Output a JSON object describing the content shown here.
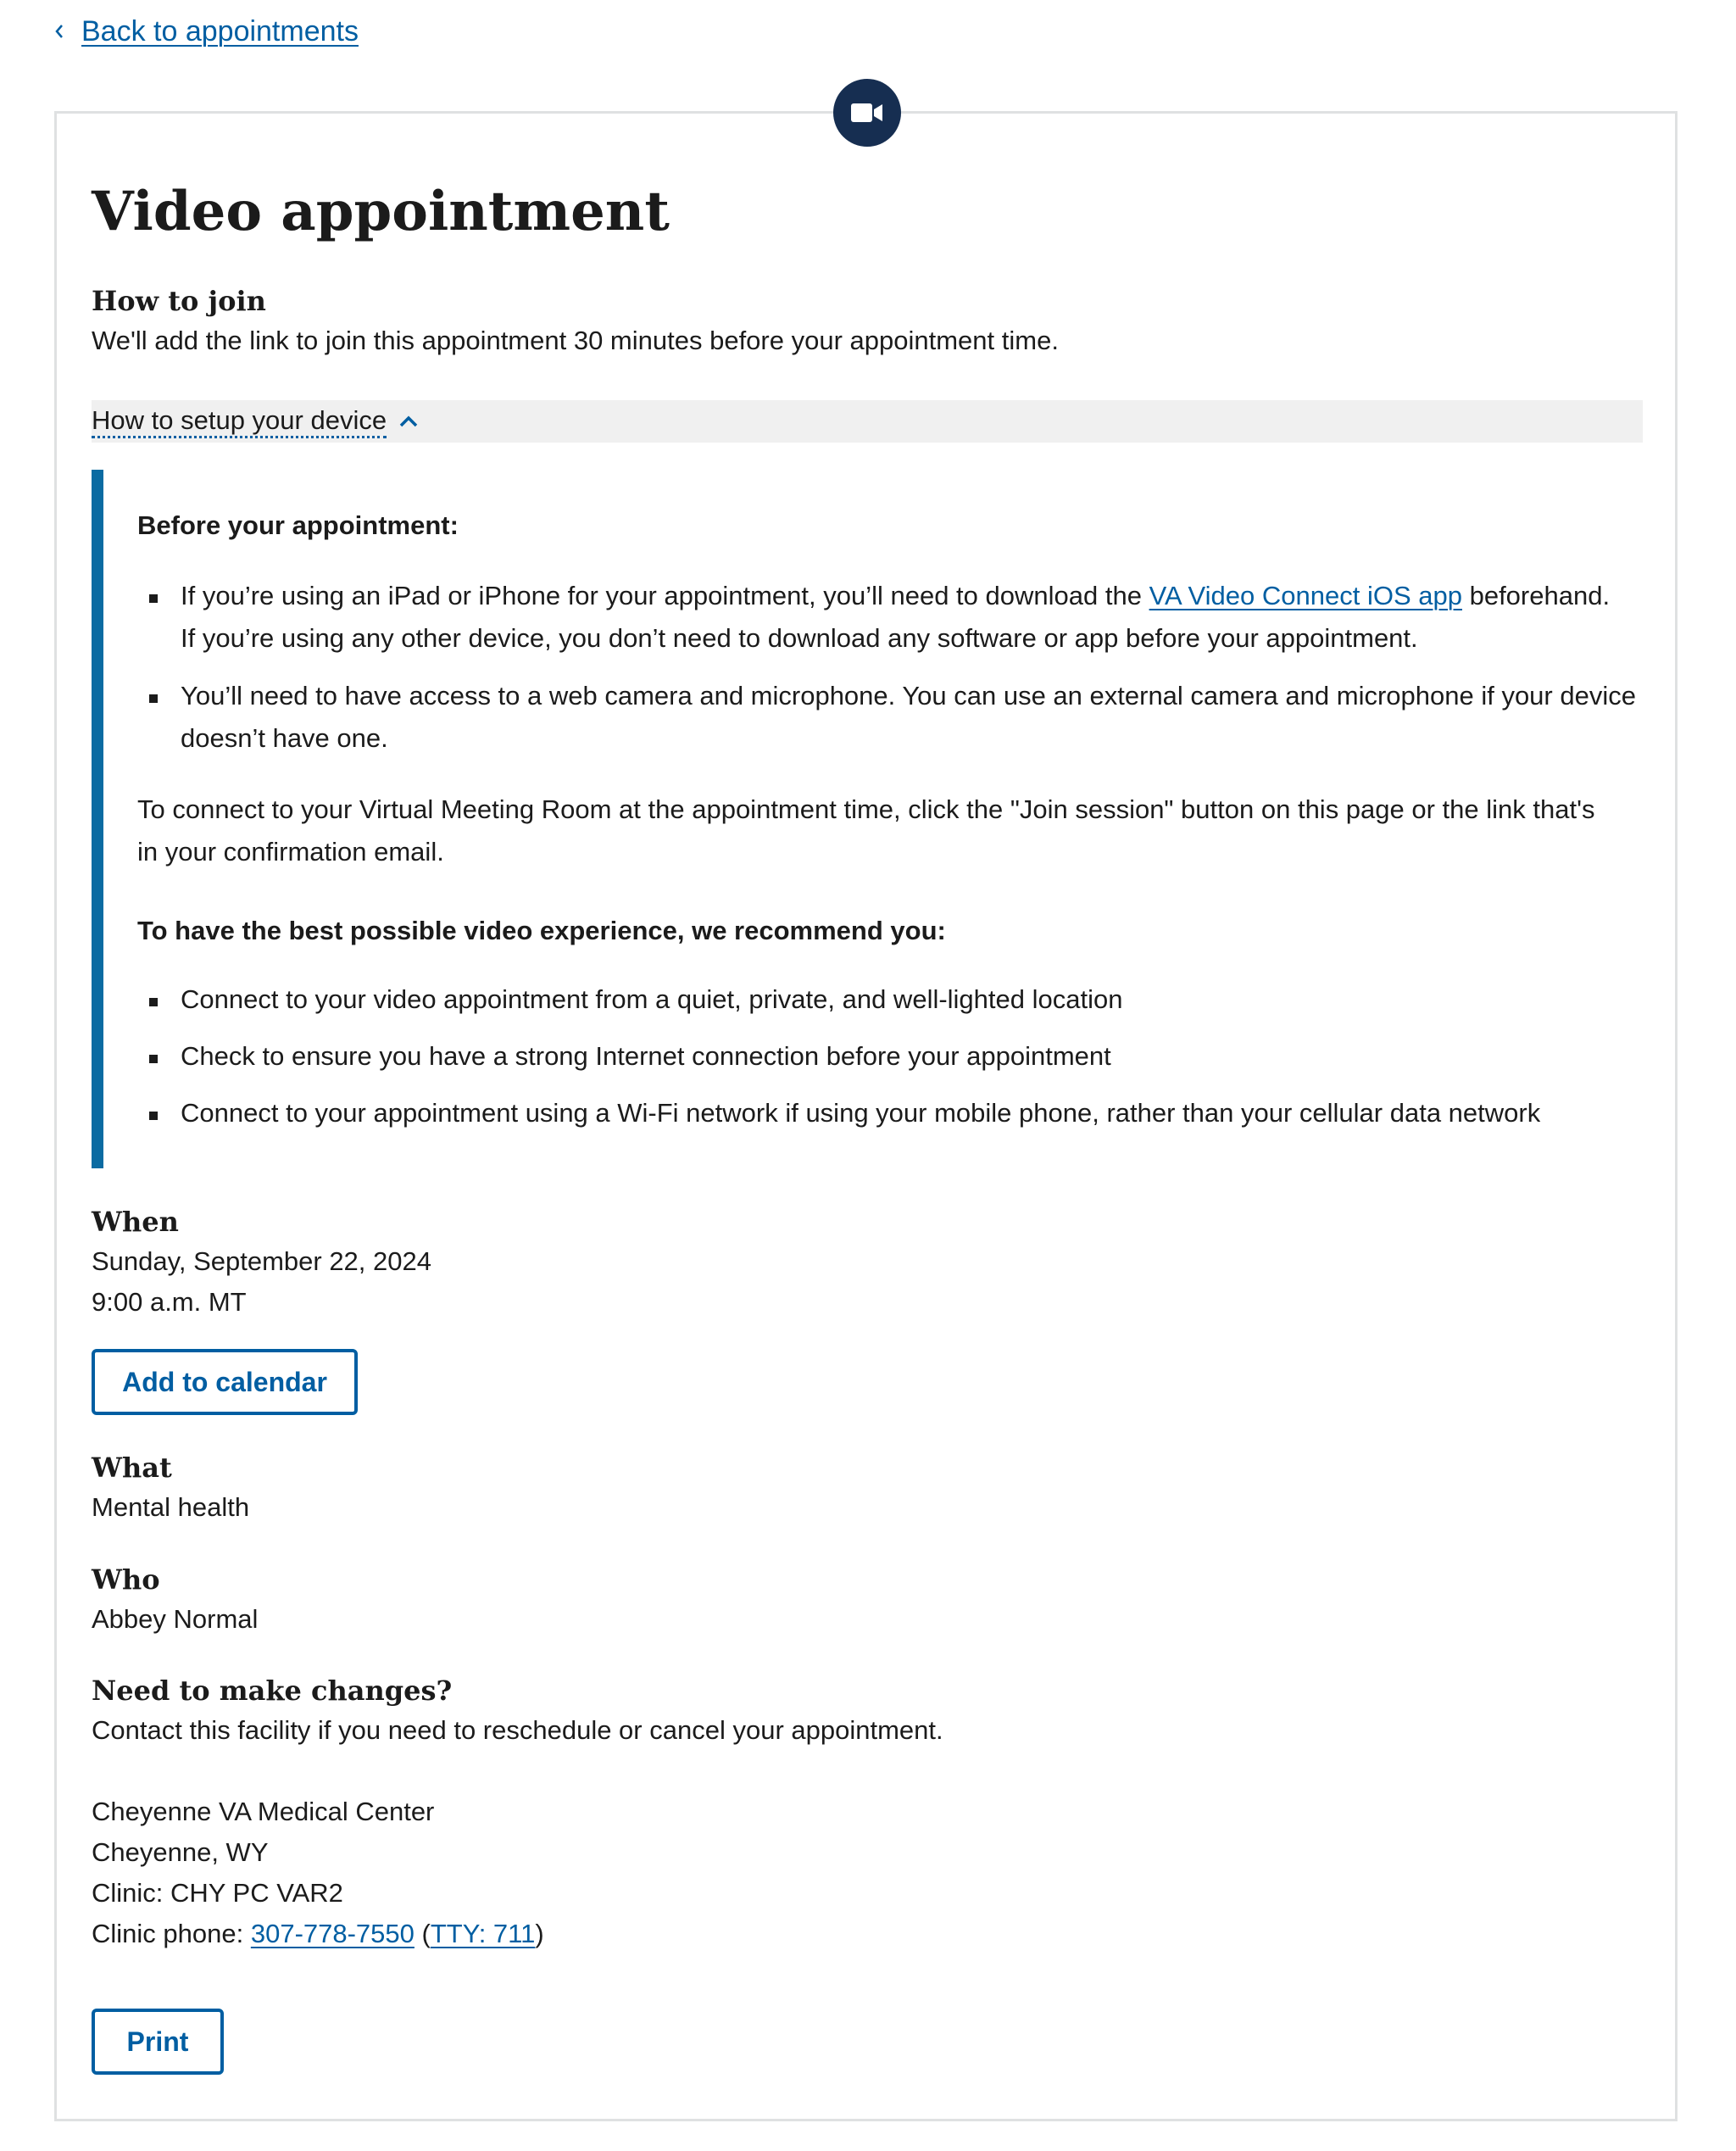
{
  "nav": {
    "back_label": "Back to appointments",
    "back_icon": "chevron-left-icon"
  },
  "appointment": {
    "icon": "video-camera-icon",
    "title": "Video appointment",
    "how_to_join": {
      "heading": "How to join",
      "text": "We'll add the link to join this appointment 30 minutes before your appointment time."
    },
    "setup": {
      "accordion_label": "How to setup your device",
      "accordion_icon": "chevron-up-icon",
      "before_heading": "Before your appointment:",
      "bullet1_pre": "If you’re using an iPad or iPhone for your appointment, you’ll need to download the ",
      "bullet1_link": "VA Video Connect iOS app",
      "bullet1_post": " beforehand.",
      "bullet1_line2": "If you’re using any other device, you don’t need to download any software or app before your appointment.",
      "bullet2_line1": "You’ll need to have access to a web camera and microphone. You can use an external camera and microphone if your device",
      "bullet2_line2": "doesn’t have one.",
      "connect_line1": "To connect to your Virtual Meeting Room at the appointment time, click the \"Join session\" button on this page or the link that's",
      "connect_line2": "in your confirmation email.",
      "recommend_heading": "To have the best possible video experience, we recommend you:",
      "recommendations": [
        "Connect to your video appointment from a quiet, private, and well-lighted location",
        "Check to ensure you have a strong Internet connection before your appointment",
        "Connect to your appointment using a Wi-Fi network if using your mobile phone, rather than your cellular data network"
      ]
    },
    "when": {
      "heading": "When",
      "date": "Sunday, September 22, 2024",
      "time": "9:00 a.m. MT",
      "calendar_button": "Add to calendar"
    },
    "what": {
      "heading": "What",
      "value": "Mental health"
    },
    "who": {
      "heading": "Who",
      "value": "Abbey Normal"
    },
    "changes": {
      "heading": "Need to make changes?",
      "text": "Contact this facility if you need to reschedule or cancel your appointment.",
      "facility": "Cheyenne VA Medical Center",
      "city": "Cheyenne, WY",
      "clinic": "Clinic: CHY PC VAR2",
      "phone_label": "Clinic phone: ",
      "phone": "307-778-7550",
      "tty": "TTY: 711",
      "open_paren": "(",
      "close_paren": ")"
    },
    "print_button": "Print"
  },
  "colors": {
    "link": "#005ea2",
    "badge": "#162e51",
    "info_border": "#0b6ba2",
    "accordion_bg": "#f0f0f0",
    "card_border": "#dfe1e2"
  }
}
